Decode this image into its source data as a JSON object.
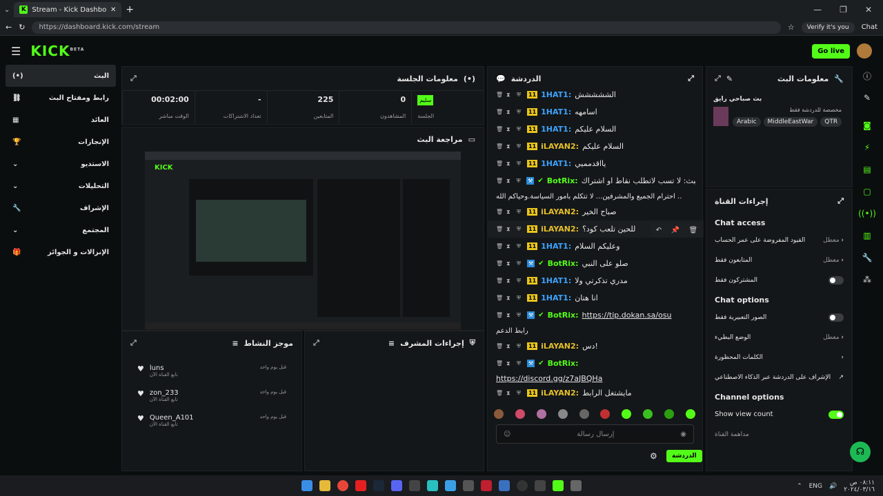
{
  "browser": {
    "tab_title": "Stream - Kick Dashboard",
    "url": "https://dashboard.kick.com/stream",
    "verify": "Verify it's you",
    "chat_label": "Chat"
  },
  "app": {
    "logo": "KICK",
    "logo_sup": "BETA",
    "go_live": "Go live"
  },
  "nav": [
    {
      "label": "البث"
    },
    {
      "label": "رابط ومفتاح البث"
    },
    {
      "label": "العائد"
    },
    {
      "label": "الإنجازات"
    },
    {
      "label": "الاستديو"
    },
    {
      "label": "التحليلات"
    },
    {
      "label": "الإشراف"
    },
    {
      "label": "المجتمع"
    },
    {
      "label": "الإنزالات و الجوائز"
    }
  ],
  "session": {
    "title": "معلومات الجلسة",
    "status": "سليم",
    "status_label": "الجلسة",
    "stats": [
      {
        "value": "0",
        "label": "المشاهدون"
      },
      {
        "value": "225",
        "label": "المتابعين"
      },
      {
        "value": "-",
        "label": "تعداد الاشتراكات"
      },
      {
        "value": "00:02:00",
        "label": "الوقت مباشر"
      }
    ]
  },
  "preview": {
    "title": "مراجعة البث"
  },
  "activity": {
    "title": "موجز النشاط",
    "items": [
      {
        "name": "luns",
        "sub": "تابع القناة الآن",
        "time": "قبل يوم واحد"
      },
      {
        "name": "zon_233",
        "sub": "تابع القناة الآن",
        "time": "قبل يوم واحد"
      },
      {
        "name": "Queen_A101",
        "sub": "تابع القناة الآن",
        "time": "قبل يوم واحد"
      }
    ]
  },
  "mod": {
    "title": "إجراءات المشرف"
  },
  "chat": {
    "title": "الدردشة",
    "messages": [
      {
        "user": "1HAT1:",
        "cls": "user-blue",
        "text": "الششششش"
      },
      {
        "user": "1HAT1:",
        "cls": "user-blue",
        "text": "اسامهه"
      },
      {
        "user": "1HAT1:",
        "cls": "user-blue",
        "text": "السلام عليكم"
      },
      {
        "user": "iLAYAN2:",
        "cls": "user-gold",
        "text": "السلام عليكم"
      },
      {
        "user": "1HAT1:",
        "cls": "user-blue",
        "text": "يااقدمميي"
      },
      {
        "user": "BotRix:",
        "cls": "user-green",
        "text": "البث: لا تسب لاتطلب نقاط او اشتراك"
      },
      {
        "user": "",
        "cls": "user-green",
        "text": "احترام الجميع والمشرفين... لا تتكلم بأمور السياسة.وحياكم الله .."
      },
      {
        "user": "iLAYAN2:",
        "cls": "user-gold",
        "text": "صباح الخير"
      },
      {
        "user": "iLAYAN2:",
        "cls": "user-gold",
        "text": "للحين تلعب كود؟"
      },
      {
        "user": "1HAT1:",
        "cls": "user-blue",
        "text": "وعليكم السلام"
      },
      {
        "user": "BotRix:",
        "cls": "user-green",
        "text": "صلو على النبي"
      },
      {
        "user": "1HAT1:",
        "cls": "user-blue",
        "text": "مدري تذكرتي ولا"
      },
      {
        "user": "1HAT1:",
        "cls": "user-blue",
        "text": "انا هتان"
      },
      {
        "user": "BotRix:",
        "cls": "user-green",
        "text": "https://tip.dokan.sa/osu"
      },
      {
        "user": "",
        "cls": "user-green",
        "text": "رابط الدعم"
      },
      {
        "user": "iLAYAN2:",
        "cls": "user-gold",
        "text": "دس!"
      },
      {
        "user": "BotRix:",
        "cls": "user-green",
        "text": ""
      },
      {
        "user": "",
        "cls": "user-green",
        "text": "https://discord.gg/z7aJBQHa"
      },
      {
        "user": "iLAYAN2:",
        "cls": "user-gold",
        "text": "مايشتغل الرابط"
      }
    ],
    "input_placeholder": "إرسال رسالة",
    "send_button": "الدردشة"
  },
  "streaminfo": {
    "title": "معلومات البث",
    "stream_name": "بث صباحي رايق",
    "category": "مخصصة للدردشة فقط",
    "tags": [
      "Arabic",
      "MiddleEastWar",
      "QTR"
    ]
  },
  "channel": {
    "title": "إجراءات القناة",
    "chat_access": "Chat access",
    "access_items": [
      {
        "label": "القيود المفروضة على عمر الحساب",
        "value": "معطل"
      },
      {
        "label": "المتابعون فقط",
        "value": "معطل"
      },
      {
        "label": "المشتركون فقط",
        "value": ""
      }
    ],
    "chat_options": "Chat options",
    "option_items": [
      {
        "label": "الصور التعبيرية فقط",
        "value": ""
      },
      {
        "label": "الوضع البطيء",
        "value": "معطل"
      },
      {
        "label": "الكلمات المحظورة",
        "value": ""
      },
      {
        "label": "الإشراف على الدردشة عبر الذكاء الاصطناعي",
        "value": ""
      }
    ],
    "channel_options": "Channel options",
    "show_view_count": "Show view count",
    "host": "مداهمة القناة"
  },
  "tray": {
    "lang": "ENG",
    "time": "٠٨:١١ ص",
    "date": "٢٠٢٤/٠٣/١٦"
  }
}
